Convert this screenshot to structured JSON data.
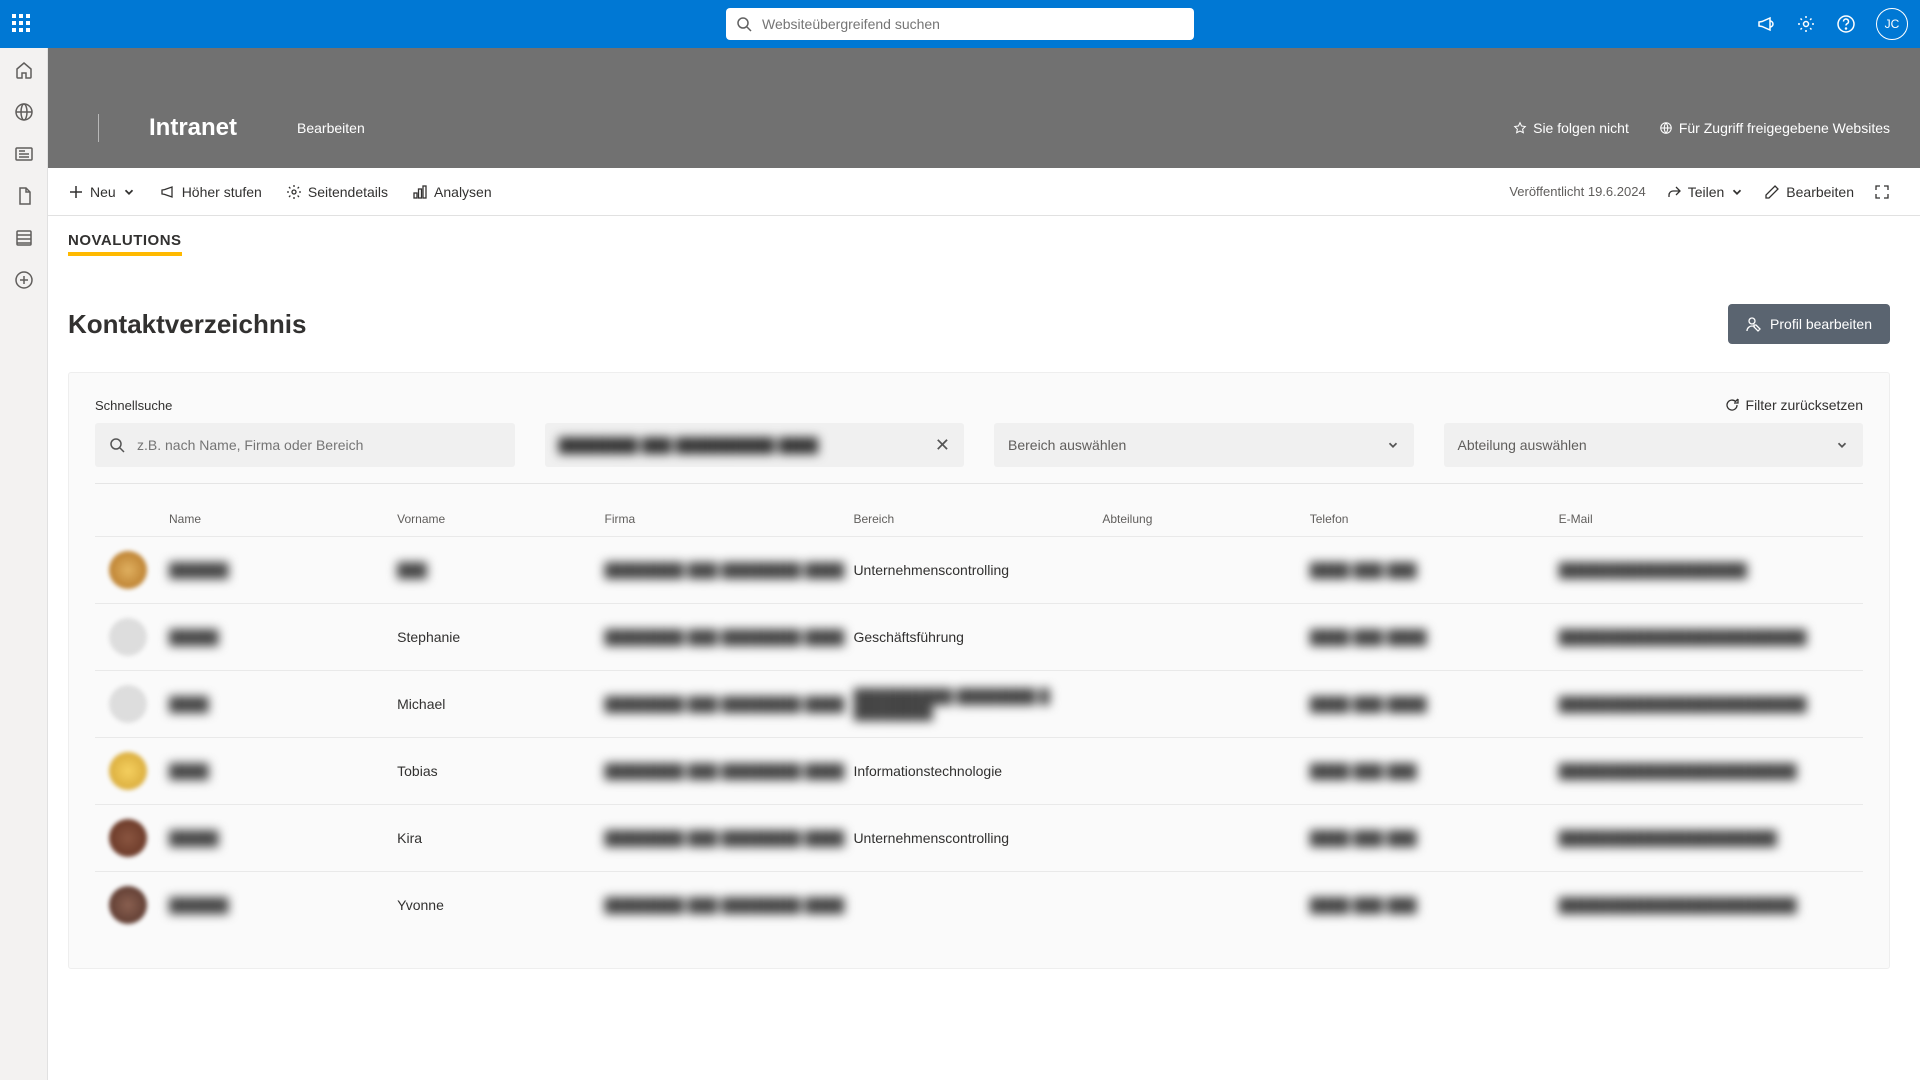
{
  "topbar": {
    "search_placeholder": "Websiteübergreifend suchen",
    "avatar_initials": "JC"
  },
  "site": {
    "title": "Intranet",
    "edit_link": "Bearbeiten",
    "follow": "Sie folgen nicht",
    "shared": "Für Zugriff freigegebene Websites"
  },
  "cmd": {
    "new": "Neu",
    "promote": "Höher stufen",
    "details": "Seitendetails",
    "analytics": "Analysen",
    "published": "Veröffentlicht 19.6.2024",
    "share": "Teilen",
    "edit": "Bearbeiten"
  },
  "brand": "NOVALUTIONS",
  "page": {
    "title": "Kontaktverzeichnis",
    "profile_btn": "Profil bearbeiten"
  },
  "filter": {
    "label": "Schnellsuche",
    "search_placeholder": "z.B. nach Name, Firma oder Bereich",
    "firma_value": "████████ ███ ██████████ ████",
    "bereich_placeholder": "Bereich auswählen",
    "abteilung_placeholder": "Abteilung auswählen",
    "reset": "Filter zurücksetzen"
  },
  "table": {
    "columns": {
      "name": "Name",
      "vorname": "Vorname",
      "firma": "Firma",
      "bereich": "Bereich",
      "abteilung": "Abteilung",
      "telefon": "Telefon",
      "email": "E-Mail"
    },
    "rows": [
      {
        "avatar": "c1",
        "name": "██████",
        "vorname_blur": true,
        "vorname": "███",
        "firma": "████████ ███ ████████ ████",
        "bereich": "Unternehmenscontrolling",
        "abteilung": "",
        "telefon": "████ ███ ███",
        "email": "███████████████████"
      },
      {
        "avatar": "c2",
        "name": "█████",
        "vorname_blur": false,
        "vorname": "Stephanie",
        "firma": "████████ ███ ████████ ████",
        "bereich": "Geschäftsführung",
        "abteilung": "",
        "telefon": "████ ███ ████",
        "email": "█████████████████████████"
      },
      {
        "avatar": "c3",
        "name": "████",
        "vorname_blur": false,
        "vorname": "Michael",
        "firma": "████████ ███ ████████ ████",
        "bereich_blur": true,
        "bereich": "██████████ ████████ █ ████████",
        "abteilung": "",
        "telefon": "████ ███ ████",
        "email": "█████████████████████████"
      },
      {
        "avatar": "c4",
        "name": "████",
        "vorname_blur": false,
        "vorname": "Tobias",
        "firma": "████████ ███ ████████ ████",
        "bereich": "Informationstechnologie",
        "abteilung": "",
        "telefon": "████ ███ ███",
        "email": "████████████████████████"
      },
      {
        "avatar": "c5",
        "name": "█████",
        "vorname_blur": false,
        "vorname": "Kira",
        "firma": "████████ ███ ████████ ████",
        "bereich": "Unternehmenscontrolling",
        "abteilung": "",
        "telefon": "████ ███ ███",
        "email": "██████████████████████"
      },
      {
        "avatar": "c6",
        "name": "██████",
        "vorname_blur": false,
        "vorname": "Yvonne",
        "firma": "████████ ███ ████████ ████",
        "bereich": "",
        "abteilung": "",
        "telefon": "████ ███ ███",
        "email": "████████████████████████"
      }
    ]
  }
}
